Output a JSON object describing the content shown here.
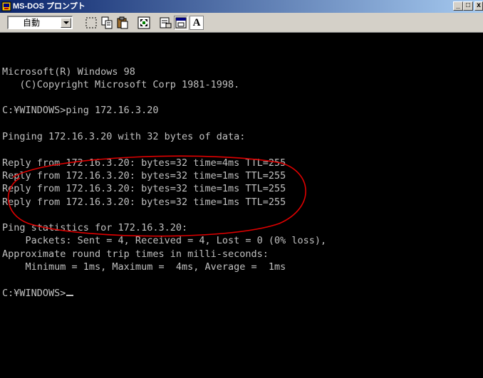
{
  "window": {
    "title": "MS-DOS プロンプト",
    "controls": {
      "minimize": "_",
      "maximize": "□",
      "close": "x"
    }
  },
  "toolbar": {
    "font_size": "自動",
    "tools": [
      "mark-icon",
      "copy-icon",
      "paste-icon",
      "fullscreen-icon",
      "properties-icon",
      "background-icon",
      "font-icon"
    ],
    "font_button_label": "A"
  },
  "console": {
    "lines": [
      "",
      "",
      "Microsoft(R) Windows 98",
      "   (C)Copyright Microsoft Corp 1981-1998.",
      "",
      "C:¥WINDOWS>ping 172.16.3.20",
      "",
      "Pinging 172.16.3.20 with 32 bytes of data:",
      "",
      "Reply from 172.16.3.20: bytes=32 time=4ms TTL=255",
      "Reply from 172.16.3.20: bytes=32 time=1ms TTL=255",
      "Reply from 172.16.3.20: bytes=32 time=1ms TTL=255",
      "Reply from 172.16.3.20: bytes=32 time=1ms TTL=255",
      "",
      "Ping statistics for 172.16.3.20:",
      "    Packets: Sent = 4, Received = 4, Lost = 0 (0% loss),",
      "Approximate round trip times in milli-seconds:",
      "    Minimum = 1ms, Maximum =  4ms, Average =  1ms",
      "",
      "C:¥WINDOWS>"
    ]
  },
  "colors": {
    "console_bg": "#000000",
    "console_text": "#c0c0c0",
    "annotation": "#e00000",
    "titlebar_start": "#0a246a",
    "titlebar_end": "#a6caf0"
  }
}
